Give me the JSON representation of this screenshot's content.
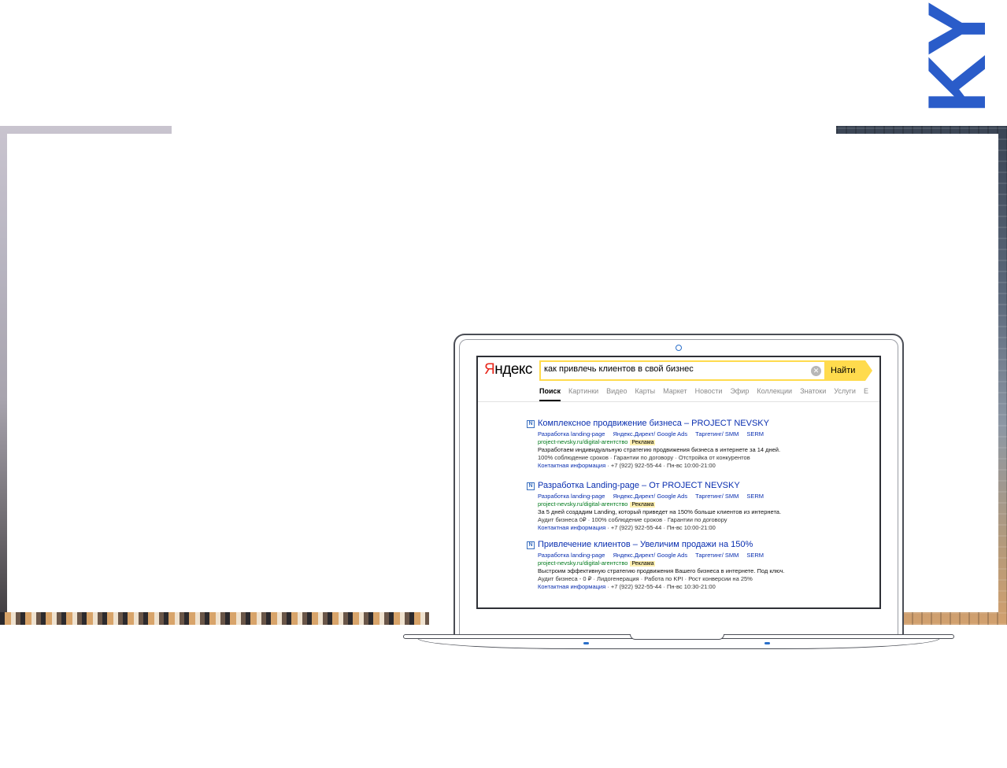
{
  "brand": {
    "logo_text": "KY",
    "color": "#2a5cc9"
  },
  "yandex": {
    "logo_first": "Я",
    "logo_rest": "ндекс",
    "search": {
      "query": "как привлечь клиентов в свой бизнес",
      "button_label": "Найти"
    },
    "tabs": [
      "Поиск",
      "Картинки",
      "Видео",
      "Карты",
      "Маркет",
      "Новости",
      "Эфир",
      "Коллекции",
      "Знатоки",
      "Услуги",
      "Е"
    ],
    "active_tab": "Поиск"
  },
  "results": [
    {
      "title": "Комплексное продвижение бизнеса – PROJECT NEVSKY",
      "links": [
        "Разработка landing-page",
        "Яндекс.Директ/ Google Ads",
        "Таргетинг/ SMM",
        "SERM"
      ],
      "url": "project-nevsky.ru/digital-агентство",
      "ad_label": "Реклама",
      "description": "Разработаем индивидуальную стратегию продвижения бизнеса в интернете за 14 дней.",
      "meta": "100% соблюдение сроков · Гарантии по договору · Отстройка от конкурентов",
      "contact_link": "Контактная информация",
      "contact_rest": " · +7 (922) 922-55-44 · Пн-вс 10:00-21:00"
    },
    {
      "title": "Разработка Landing-page – От PROJECT NEVSKY",
      "links": [
        "Разработка landing-page",
        "Яндекс.Директ/ Google Ads",
        "Таргетинг/ SMM",
        "SERM"
      ],
      "url": "project-nevsky.ru/digital-агентство",
      "ad_label": "Реклама",
      "description": "За 5 дней создадим Landing, который приведет на 150% больше клиентов из интернета.",
      "meta": "Аудит бизнеса 0₽ · 100% соблюдение сроков · Гарантии по договору",
      "contact_link": "Контактная информация",
      "contact_rest": " · +7 (922) 922-55-44 · Пн-вс 10:00-21:00"
    },
    {
      "title": "Привлечение клиентов – Увеличим продажи на 150%",
      "links": [
        "Разработка landing-page",
        "Яндекс.Директ/ Google Ads",
        "Таргетинг/ SMM",
        "SERM"
      ],
      "url": "project-nevsky.ru/digital-агентство",
      "ad_label": "Реклама",
      "description": "Выстроим эффективную стратегию продвижения Вашего бизнеса в интернете. Под ключ.",
      "meta": "Аудит бизнеса - 0 ₽ · Лидогенерация · Работа по KPI · Рост конверсии на 25%",
      "contact_link": "Контактная информация",
      "contact_rest": " · +7 (922) 922-55-44 · Пн-вс 10:30-21:00"
    }
  ]
}
